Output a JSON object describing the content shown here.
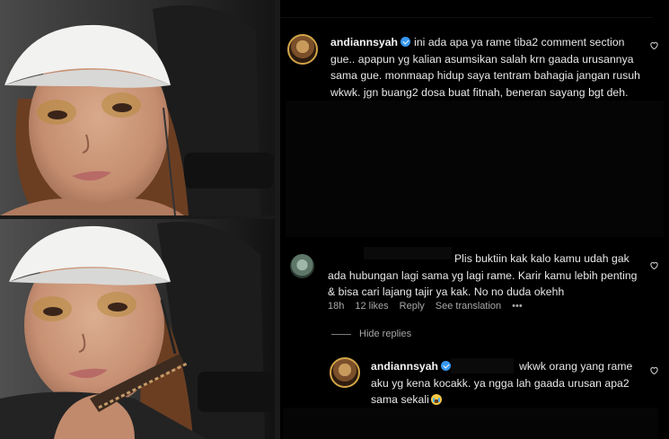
{
  "comments": [
    {
      "username": "andiannsyah",
      "verified": true,
      "text": "ini ada apa ya rame tiba2 comment section gue.. apapun yg kalian asumsikan salah krn gaada urusannya sama gue. monmaap hidup saya tentram bahagia jangan rusuh wkwk. jgn buang2 dosa buat fitnah, beneran sayang bgt deh."
    },
    {
      "username": "",
      "text": "Plis buktiin kak kalo kamu udah gak ada hubungan lagi sama yg lagi rame. Karir kamu lebih penting & bisa cari lajang tajir ya kak. No no duda okehh",
      "time": "18h",
      "likes": "12 likes",
      "reply_label": "Reply",
      "translate_label": "See translation",
      "more": "•••",
      "hide_replies": "Hide replies"
    },
    {
      "username": "andiannsyah",
      "verified": true,
      "text": "wkwk orang yang rame aku yg kena kocakk. ya ngga lah gaada urusan apa2 sama sekali"
    }
  ],
  "icons": {
    "like": "heart-outline-icon",
    "verified": "verified-badge-icon",
    "emoji": "crying-laughing-emoji"
  },
  "colors": {
    "panel_bg": "#000000",
    "text": "#e9e9e9",
    "meta": "#a8a8a8",
    "verified": "#3897f0",
    "avatar_ring": "#d3a548"
  }
}
